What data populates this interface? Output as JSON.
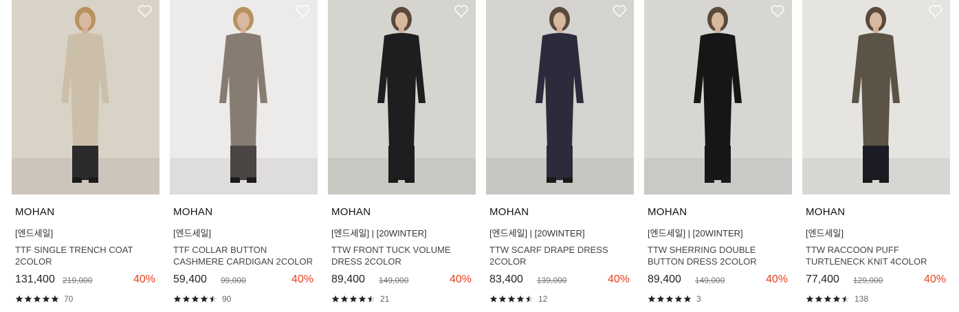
{
  "products": [
    {
      "brand": "MOHAN",
      "tags": "[엔드세일]",
      "name": "TTF SINGLE TRENCH COAT 2COLOR",
      "price": "131,400",
      "original_price": "219,000",
      "discount": "40%",
      "rating": 5,
      "review_count": "70",
      "photo": "woman-in-beige-trench-coat",
      "colors": {
        "bg": "#d9d2c7",
        "garment": "#cbbfa9",
        "pants": "#2b2b2b"
      }
    },
    {
      "brand": "MOHAN",
      "tags": "[엔드세일]",
      "name": "TTF COLLAR BUTTON CASHMERE CARDIGAN 2COLOR",
      "price": "59,400",
      "original_price": "99,000",
      "discount": "40%",
      "rating": 4.5,
      "review_count": "90",
      "photo": "woman-in-taupe-cardigan",
      "colors": {
        "bg": "#ecebea",
        "garment": "#867c72",
        "pants": "#4a4543"
      }
    },
    {
      "brand": "MOHAN",
      "tags": "[엔드세일] | [20WINTER]",
      "name": "TTW FRONT TUCK VOLUME DRESS 2COLOR",
      "price": "89,400",
      "original_price": "149,000",
      "discount": "40%",
      "rating": 4.5,
      "review_count": "21",
      "photo": "woman-in-black-volume-dress",
      "colors": {
        "bg": "#d6d4cf",
        "garment": "#1e1e20",
        "pants": "#1e1e20"
      }
    },
    {
      "brand": "MOHAN",
      "tags": "[엔드세일] | [20WINTER]",
      "name": "TTW SCARF DRAPE DRESS 2COLOR",
      "price": "83,400",
      "original_price": "139,000",
      "discount": "40%",
      "rating": 4.5,
      "review_count": "12",
      "photo": "woman-in-navy-drape-dress",
      "colors": {
        "bg": "#d5d3cf",
        "garment": "#2c2b3b",
        "pants": "#2c2b3b"
      }
    },
    {
      "brand": "MOHAN",
      "tags": "[엔드세일] | [20WINTER]",
      "name": "TTW SHERRING DOUBLE BUTTON DRESS 2COLOR",
      "price": "89,400",
      "original_price": "149,000",
      "discount": "40%",
      "rating": 5,
      "review_count": "3",
      "photo": "woman-in-black-button-dress",
      "colors": {
        "bg": "#d8d6d2",
        "garment": "#161617",
        "pants": "#161617"
      }
    },
    {
      "brand": "MOHAN",
      "tags": "[엔드세일]",
      "name": "TTW RACCOON PUFF TURTLENECK KNIT 4COLOR",
      "price": "77,400",
      "original_price": "129,000",
      "discount": "40%",
      "rating": 4.5,
      "review_count": "138",
      "photo": "woman-in-khaki-turtleneck-knit",
      "colors": {
        "bg": "#e6e4e0",
        "garment": "#5b5446",
        "pants": "#1c1d24"
      }
    }
  ],
  "icons": {
    "wishlist": "heart-outline-icon",
    "star": "star-icon"
  }
}
